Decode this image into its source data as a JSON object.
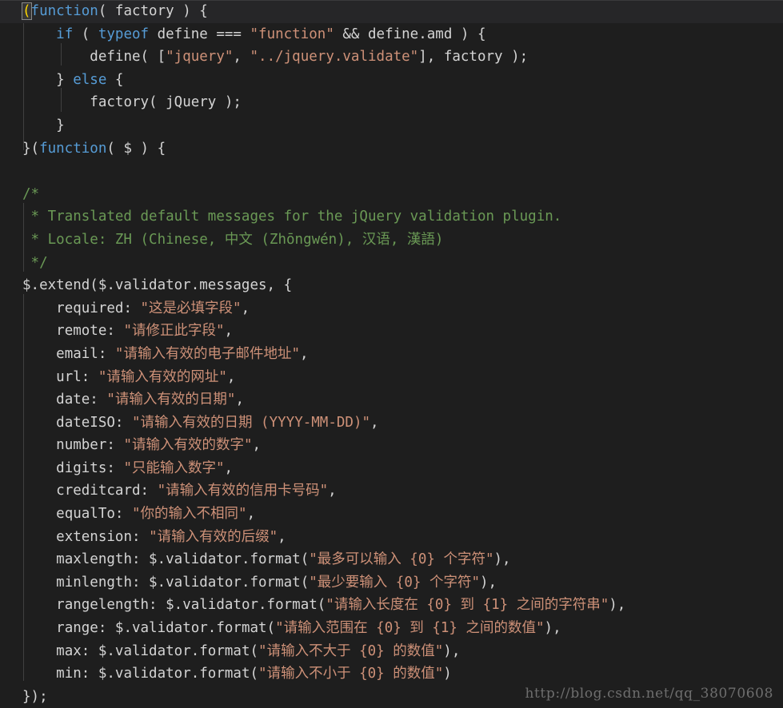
{
  "editor": {
    "background_color": "#1e1e1e",
    "current_line_color": "#262628",
    "foreground_color": "#d4d4d4",
    "keyword_color": "#569cd6",
    "string_color": "#ce9178",
    "comment_color": "#6a9955",
    "bracket_yellow": "#ffd700",
    "bracket_magenta": "#da70d6",
    "bracket_blue": "#179fff",
    "indent_guide_color": "#404040",
    "language": "JavaScript"
  },
  "watermark": {
    "text": "http://blog.csdn.net/qq_38070608",
    "color": "#7c7c7c"
  },
  "code": {
    "l01_open_paren": "(",
    "l01_function": "function",
    "l01_rest": "( factory ) {",
    "l02_if": "if",
    "l02_a": " ( ",
    "l02_typeof": "typeof",
    "l02_b": " define === ",
    "l02_str": "\"function\"",
    "l02_c": " && define.amd ) {",
    "l03_a": "define( [",
    "l03_str1": "\"jquery\"",
    "l03_b": ", ",
    "l03_str2": "\"../jquery.validate\"",
    "l03_c": "], factory );",
    "l04_a": "} ",
    "l04_else": "else",
    "l04_b": " {",
    "l05": "factory( jQuery );",
    "l06": "}",
    "l07_a": "}(",
    "l07_function": "function",
    "l07_b": "( $ ) {",
    "l08": "",
    "l09_comment": "/*",
    "l10_comment": " * Translated default messages for the jQuery validation plugin.",
    "l11_comment": " * Locale: ZH (Chinese, 中文 (Zhōngwén), 汉语, 漢語)",
    "l12_comment": " */",
    "l13": "$.extend($.validator.messages, {",
    "required_key": "required: ",
    "required_val": "\"这是必填字段\"",
    "remote_key": "remote: ",
    "remote_val": "\"请修正此字段\"",
    "email_key": "email: ",
    "email_val": "\"请输入有效的电子邮件地址\"",
    "url_key": "url: ",
    "url_val": "\"请输入有效的网址\"",
    "date_key": "date: ",
    "date_val": "\"请输入有效的日期\"",
    "dateISO_key": "dateISO: ",
    "dateISO_val": "\"请输入有效的日期 (YYYY-MM-DD)\"",
    "number_key": "number: ",
    "number_val": "\"请输入有效的数字\"",
    "digits_key": "digits: ",
    "digits_val": "\"只能输入数字\"",
    "creditcard_key": "creditcard: ",
    "creditcard_val": "\"请输入有效的信用卡号码\"",
    "equalTo_key": "equalTo: ",
    "equalTo_val": "\"你的输入不相同\"",
    "extension_key": "extension: ",
    "extension_val": "\"请输入有效的后缀\"",
    "maxlength_key": "maxlength: $.validator.format(",
    "maxlength_val": "\"最多可以输入 {0} 个字符\"",
    "minlength_key": "minlength: $.validator.format(",
    "minlength_val": "\"最少要输入 {0} 个字符\"",
    "rangelength_key": "rangelength: $.validator.format(",
    "rangelength_val": "\"请输入长度在 {0} 到 {1} 之间的字符串\"",
    "range_key": "range: $.validator.format(",
    "range_val": "\"请输入范围在 {0} 到 {1} 之间的数值\"",
    "max_key": "max: $.validator.format(",
    "max_val": "\"请输入不大于 {0} 的数值\"",
    "min_key": "min: $.validator.format(",
    "min_val": "\"请输入不小于 {0} 的数值\"",
    "close_paren_comma": "),",
    "close_paren": ")",
    "comma": ",",
    "l_end": "});"
  }
}
